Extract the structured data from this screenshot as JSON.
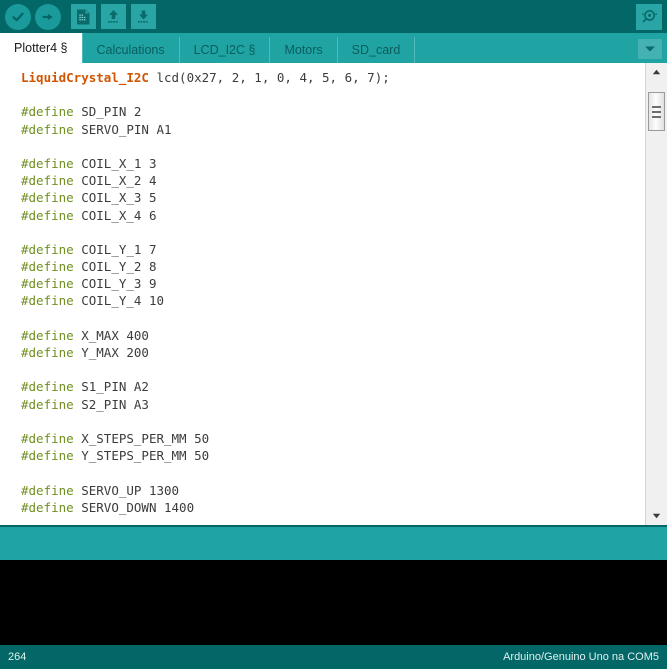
{
  "toolbar": {
    "buttons": [
      {
        "name": "verify-button",
        "icon": "check-icon",
        "label": "Verify"
      },
      {
        "name": "upload-button",
        "icon": "arrow-right-icon",
        "label": "Upload"
      },
      {
        "name": "new-button",
        "icon": "new-document-icon",
        "label": "New"
      },
      {
        "name": "open-button",
        "icon": "arrow-up-icon",
        "label": "Open"
      },
      {
        "name": "save-button",
        "icon": "arrow-down-icon",
        "label": "Save"
      }
    ],
    "serial_monitor": {
      "name": "serial-monitor-button",
      "icon": "magnifier-icon",
      "label": "Serial Monitor"
    }
  },
  "tabs": [
    {
      "label": "Plotter4 §",
      "active": true
    },
    {
      "label": "Calculations",
      "active": false
    },
    {
      "label": "LCD_I2C §",
      "active": false
    },
    {
      "label": "Motors",
      "active": false
    },
    {
      "label": "SD_card",
      "active": false
    }
  ],
  "tab_menu": {
    "icon": "chevron-down-icon",
    "label": "Tab menu"
  },
  "editor": {
    "lines": [
      [
        {
          "t": "LiquidCrystal_I2C",
          "c": "type"
        },
        {
          "t": " lcd(0x27, 2, 1, 0, 4, 5, 6, 7);",
          "c": "plain"
        }
      ],
      [],
      [
        {
          "t": "#define",
          "c": "pre"
        },
        {
          "t": " SD_PIN 2",
          "c": "plain"
        }
      ],
      [
        {
          "t": "#define",
          "c": "pre"
        },
        {
          "t": " SERVO_PIN A1",
          "c": "plain"
        }
      ],
      [],
      [
        {
          "t": "#define",
          "c": "pre"
        },
        {
          "t": " COIL_X_1 3",
          "c": "plain"
        }
      ],
      [
        {
          "t": "#define",
          "c": "pre"
        },
        {
          "t": " COIL_X_2 4",
          "c": "plain"
        }
      ],
      [
        {
          "t": "#define",
          "c": "pre"
        },
        {
          "t": " COIL_X_3 5",
          "c": "plain"
        }
      ],
      [
        {
          "t": "#define",
          "c": "pre"
        },
        {
          "t": " COIL_X_4 6",
          "c": "plain"
        }
      ],
      [],
      [
        {
          "t": "#define",
          "c": "pre"
        },
        {
          "t": " COIL_Y_1 7",
          "c": "plain"
        }
      ],
      [
        {
          "t": "#define",
          "c": "pre"
        },
        {
          "t": " COIL_Y_2 8",
          "c": "plain"
        }
      ],
      [
        {
          "t": "#define",
          "c": "pre"
        },
        {
          "t": " COIL_Y_3 9",
          "c": "plain"
        }
      ],
      [
        {
          "t": "#define",
          "c": "pre"
        },
        {
          "t": " COIL_Y_4 10",
          "c": "plain"
        }
      ],
      [],
      [
        {
          "t": "#define",
          "c": "pre"
        },
        {
          "t": " X_MAX 400",
          "c": "plain"
        }
      ],
      [
        {
          "t": "#define",
          "c": "pre"
        },
        {
          "t": " Y_MAX 200",
          "c": "plain"
        }
      ],
      [],
      [
        {
          "t": "#define",
          "c": "pre"
        },
        {
          "t": " S1_PIN A2",
          "c": "plain"
        }
      ],
      [
        {
          "t": "#define",
          "c": "pre"
        },
        {
          "t": " S2_PIN A3",
          "c": "plain"
        }
      ],
      [],
      [
        {
          "t": "#define",
          "c": "pre"
        },
        {
          "t": " X_STEPS_PER_MM 50",
          "c": "plain"
        }
      ],
      [
        {
          "t": "#define",
          "c": "pre"
        },
        {
          "t": " Y_STEPS_PER_MM 50",
          "c": "plain"
        }
      ],
      [],
      [
        {
          "t": "#define",
          "c": "pre"
        },
        {
          "t": " SERVO_UP 1300",
          "c": "plain"
        }
      ],
      [
        {
          "t": "#define",
          "c": "pre"
        },
        {
          "t": " SERVO_DOWN 1400",
          "c": "plain"
        }
      ]
    ]
  },
  "scrollbar": {
    "up_icon": "triangle-up-icon",
    "down_icon": "triangle-down-icon",
    "thumb": "scroll-thumb"
  },
  "statusbar": {
    "line_number": "264",
    "board_info": "Arduino/Genuino Uno na COM5"
  },
  "colors": {
    "toolbar_bg": "#046767",
    "tabbar_bg": "#1fa3a3",
    "active_tab_bg": "#ffffff",
    "editor_bg": "#ffffff",
    "console_bg": "#000000",
    "preprocessor": "#6f8f1e",
    "type_keyword": "#d35400",
    "code_text": "#3c3c3c"
  }
}
